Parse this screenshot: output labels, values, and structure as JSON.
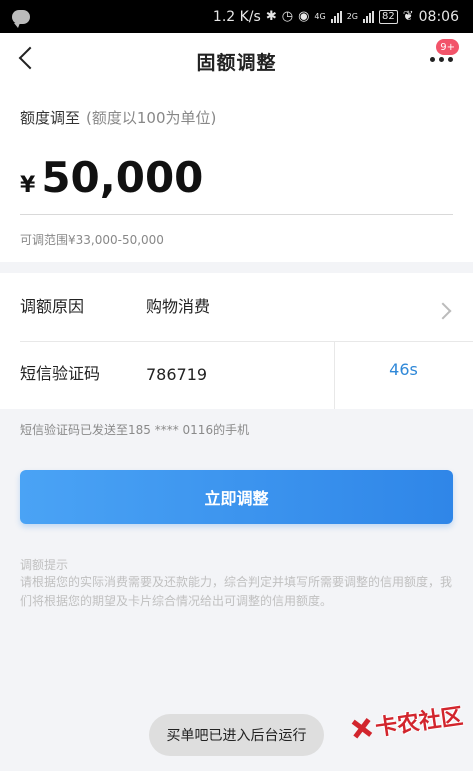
{
  "status_bar": {
    "speed": "1.2 K/s",
    "net1": "4G",
    "net2": "2G",
    "battery": "82",
    "time": "08:06"
  },
  "nav": {
    "title": "固额调整",
    "badge": "9+"
  },
  "amount": {
    "label": "额度调至",
    "hint": "(额度以100为单位)",
    "currency": "¥",
    "value": "50,000",
    "range": "可调范围¥33,000-50,000"
  },
  "form": {
    "reason_label": "调额原因",
    "reason_value": "购物消费",
    "code_label": "短信验证码",
    "code_value": "786719",
    "countdown": "46s"
  },
  "sms_note": "短信验证码已发送至185 **** 0116的手机",
  "submit_label": "立即调整",
  "tips": {
    "title": "调额提示",
    "body": "请根据您的实际消费需要及还款能力，综合判定并填写所需要调整的信用额度，我们将根据您的期望及卡片综合情况给出可调整的信用额度。"
  },
  "toast": "买单吧已进入后台运行",
  "watermark": "卡农社区",
  "colors": {
    "accent": "#2f88d8",
    "badge": "#f2546a",
    "watermark": "#d2252d"
  }
}
